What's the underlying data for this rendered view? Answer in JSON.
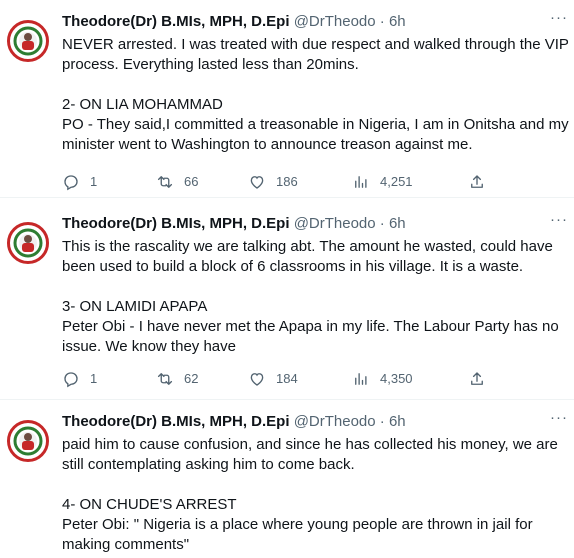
{
  "tweets": [
    {
      "author_name": "Theodore(Dr) B.MIs, MPH, D.Epi",
      "handle": "@DrTheodo",
      "separator": "·",
      "time": "6h",
      "more_label": "···",
      "paragraphs": [
        "NEVER arrested. I was treated with due respect and walked through the VIP process. Everything lasted less than 20mins.",
        "",
        "2- ON LIA MOHAMMAD",
        "PO - They said,I committed a treasonable in Nigeria, I am in Onitsha and my minister went to Washington to announce treason against me."
      ],
      "stats": {
        "replies": "1",
        "retweets": "66",
        "likes": "186",
        "views": "4,251"
      }
    },
    {
      "author_name": "Theodore(Dr) B.MIs, MPH, D.Epi",
      "handle": "@DrTheodo",
      "separator": "·",
      "time": "6h",
      "more_label": "···",
      "paragraphs": [
        "This is the rascality we are talking abt. The amount he wasted, could have been used to build a block of 6 classrooms in his village. It is a waste.",
        "",
        "3- ON LAMIDI APAPA",
        "Peter Obi - I have never met the Apapa in my life. The Labour Party has no issue. We know they have"
      ],
      "stats": {
        "replies": "1",
        "retweets": "62",
        "likes": "184",
        "views": "4,350"
      }
    },
    {
      "author_name": "Theodore(Dr) B.MIs, MPH, D.Epi",
      "handle": "@DrTheodo",
      "separator": "·",
      "time": "6h",
      "more_label": "···",
      "paragraphs": [
        "paid him to cause confusion, and since he has collected his money, we are still contemplating asking him to come back.",
        "",
        "4- ON CHUDE'S ARREST",
        "Peter Obi: \" Nigeria is a place where young people are thrown in jail for making comments\""
      ]
    }
  ],
  "icons": {
    "reply": "reply-icon",
    "retweet": "retweet-icon",
    "like": "heart-icon",
    "views": "views-icon",
    "share": "share-icon",
    "more": "more-icon"
  },
  "colors": {
    "name": "#0f1419",
    "meta": "#536471",
    "avatar_ring": "#c62828",
    "divider": "#eff3f4"
  }
}
